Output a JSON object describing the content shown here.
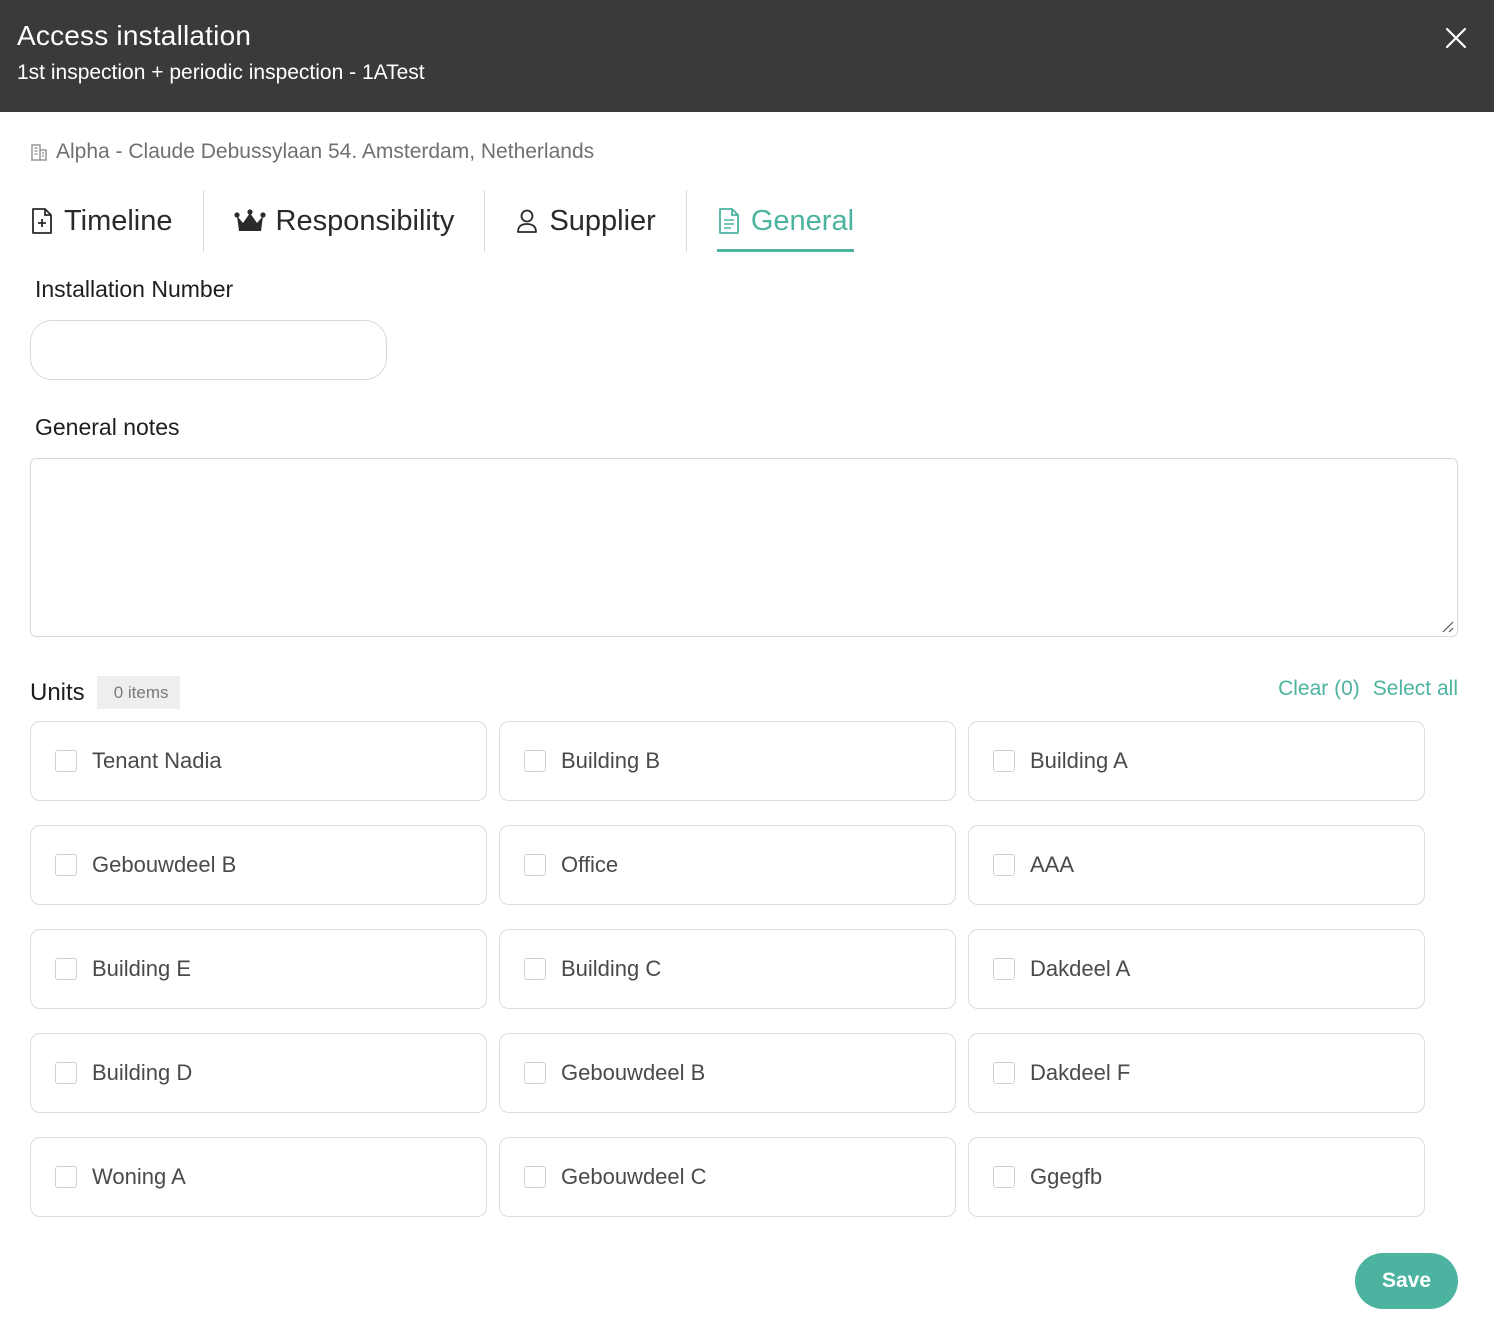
{
  "header": {
    "title": "Access installation",
    "subtitle": "1st inspection + periodic inspection - 1ATest",
    "close_icon": "close-icon"
  },
  "location": {
    "icon": "building-icon",
    "text": "Alpha - Claude Debussylaan 54. Amsterdam, Netherlands"
  },
  "tabs": [
    {
      "label": "Timeline",
      "icon": "document-plus-icon",
      "active": false
    },
    {
      "label": "Responsibility",
      "icon": "crown-icon",
      "active": false
    },
    {
      "label": "Supplier",
      "icon": "user-icon",
      "active": false
    },
    {
      "label": "General",
      "icon": "document-icon",
      "active": true
    }
  ],
  "form": {
    "installation_number_label": "Installation Number",
    "installation_number_value": "",
    "general_notes_label": "General notes",
    "general_notes_value": ""
  },
  "units": {
    "title": "Units",
    "count_badge": "0 items",
    "clear_label": "Clear (0)",
    "select_all_label": "Select all",
    "items": [
      "Tenant Nadia",
      "Building B",
      "Building A",
      "Gebouwdeel B",
      "Office",
      "AAA",
      "Building E",
      "Building C",
      "Dakdeel A",
      "Building D",
      "Gebouwdeel B",
      "Dakdeel F",
      "Woning A",
      "Gebouwdeel C",
      "Ggegfb"
    ]
  },
  "footer": {
    "save_label": "Save"
  },
  "colors": {
    "header_bg": "#3a3a3a",
    "accent": "#4cb3a0"
  }
}
